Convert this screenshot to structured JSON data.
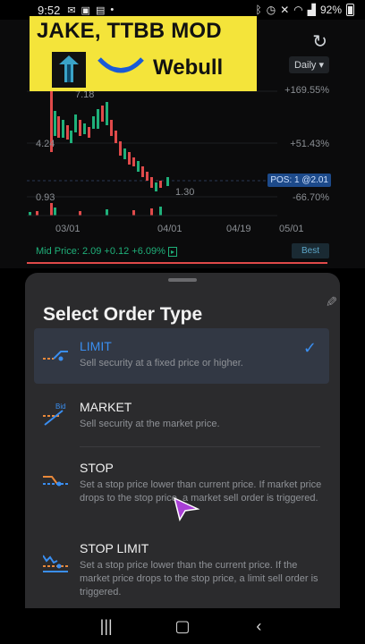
{
  "status_bar": {
    "time": "9:52",
    "battery": "92%"
  },
  "chart": {
    "high_label": "7.18",
    "mid_label": "4.24",
    "low_label": "0.93",
    "last_low_label": "1.30",
    "pct_top": "+169.55%",
    "pct_mid": "+51.43%",
    "pct_low": "-66.70%",
    "position_badge": "POS: 1 @2.01",
    "period_select": "Daily",
    "x_ticks": [
      "03/01",
      "04/01",
      "04/19",
      "05/01"
    ],
    "mid_price": "Mid Price: 2.09 +0.12 +6.09%",
    "best_button": "Best"
  },
  "banner": {
    "title": "JAKE, TTBB MOD",
    "brand": "Webull"
  },
  "sheet": {
    "title": "Select Order Type",
    "options": [
      {
        "name": "LIMIT",
        "description": "Sell security at a fixed price or higher.",
        "selected": true,
        "icon": "limit-order-icon"
      },
      {
        "name": "MARKET",
        "description": "Sell security at the market price.",
        "selected": false,
        "icon": "market-order-icon",
        "icon_label": "Bid"
      },
      {
        "name": "STOP",
        "description": "Set a stop price lower than current price. If market price drops to the stop price, a market sell order is triggered.",
        "selected": false,
        "icon": "stop-order-icon"
      },
      {
        "name": "STOP LIMIT",
        "description": "Set a stop price lower than the current price. If the market price drops to the stop price, a limit sell order is triggered.",
        "selected": false,
        "icon": "stop-limit-order-icon"
      }
    ]
  },
  "colors": {
    "accent": "#3a8ef0",
    "sheet_bg": "#2b2b2d",
    "gain": "#1fb07a",
    "loss": "#e04a4a",
    "banner": "#f4e43a"
  }
}
